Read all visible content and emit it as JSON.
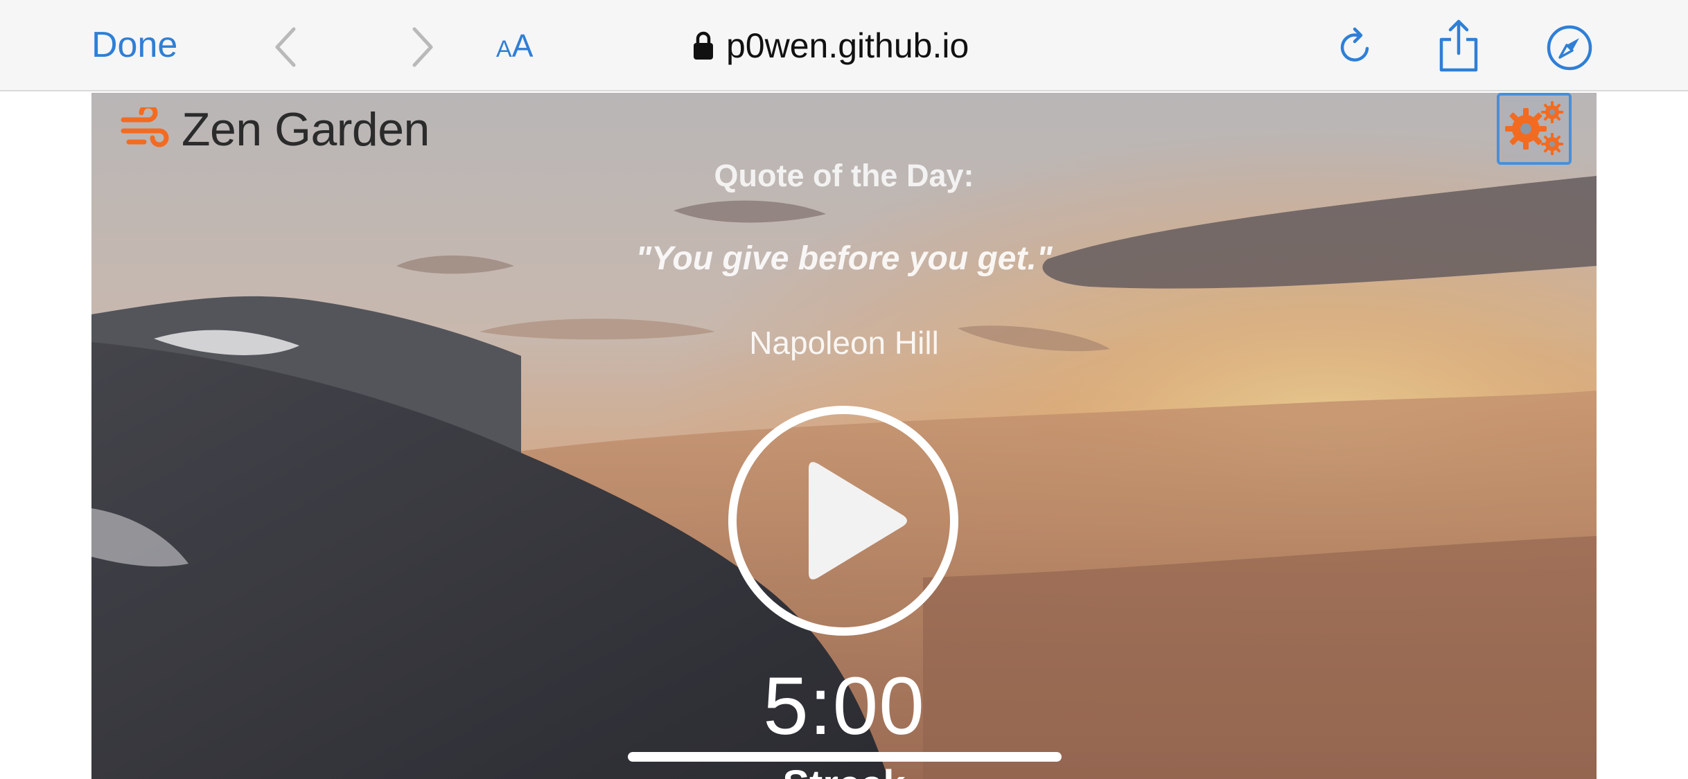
{
  "browser": {
    "done_label": "Done",
    "aa_small": "A",
    "aa_big": "A",
    "url": "p0wen.github.io",
    "accent_color": "#2f7fd6"
  },
  "app": {
    "name": "Zen Garden",
    "brand_color": "#f26b21",
    "quote_label": "Quote of the Day:",
    "quote_text": "\"You give before you get.\"",
    "quote_author": "Napoleon Hill",
    "timer": "5:00",
    "progress_fraction": 1.0,
    "streak_label": "Streak"
  },
  "icons": {
    "brand": "wind-icon",
    "settings": "gears-icon",
    "play": "play-circle-icon",
    "lock": "lock-icon",
    "reload": "reload-icon",
    "share": "share-icon",
    "compass": "compass-icon"
  }
}
